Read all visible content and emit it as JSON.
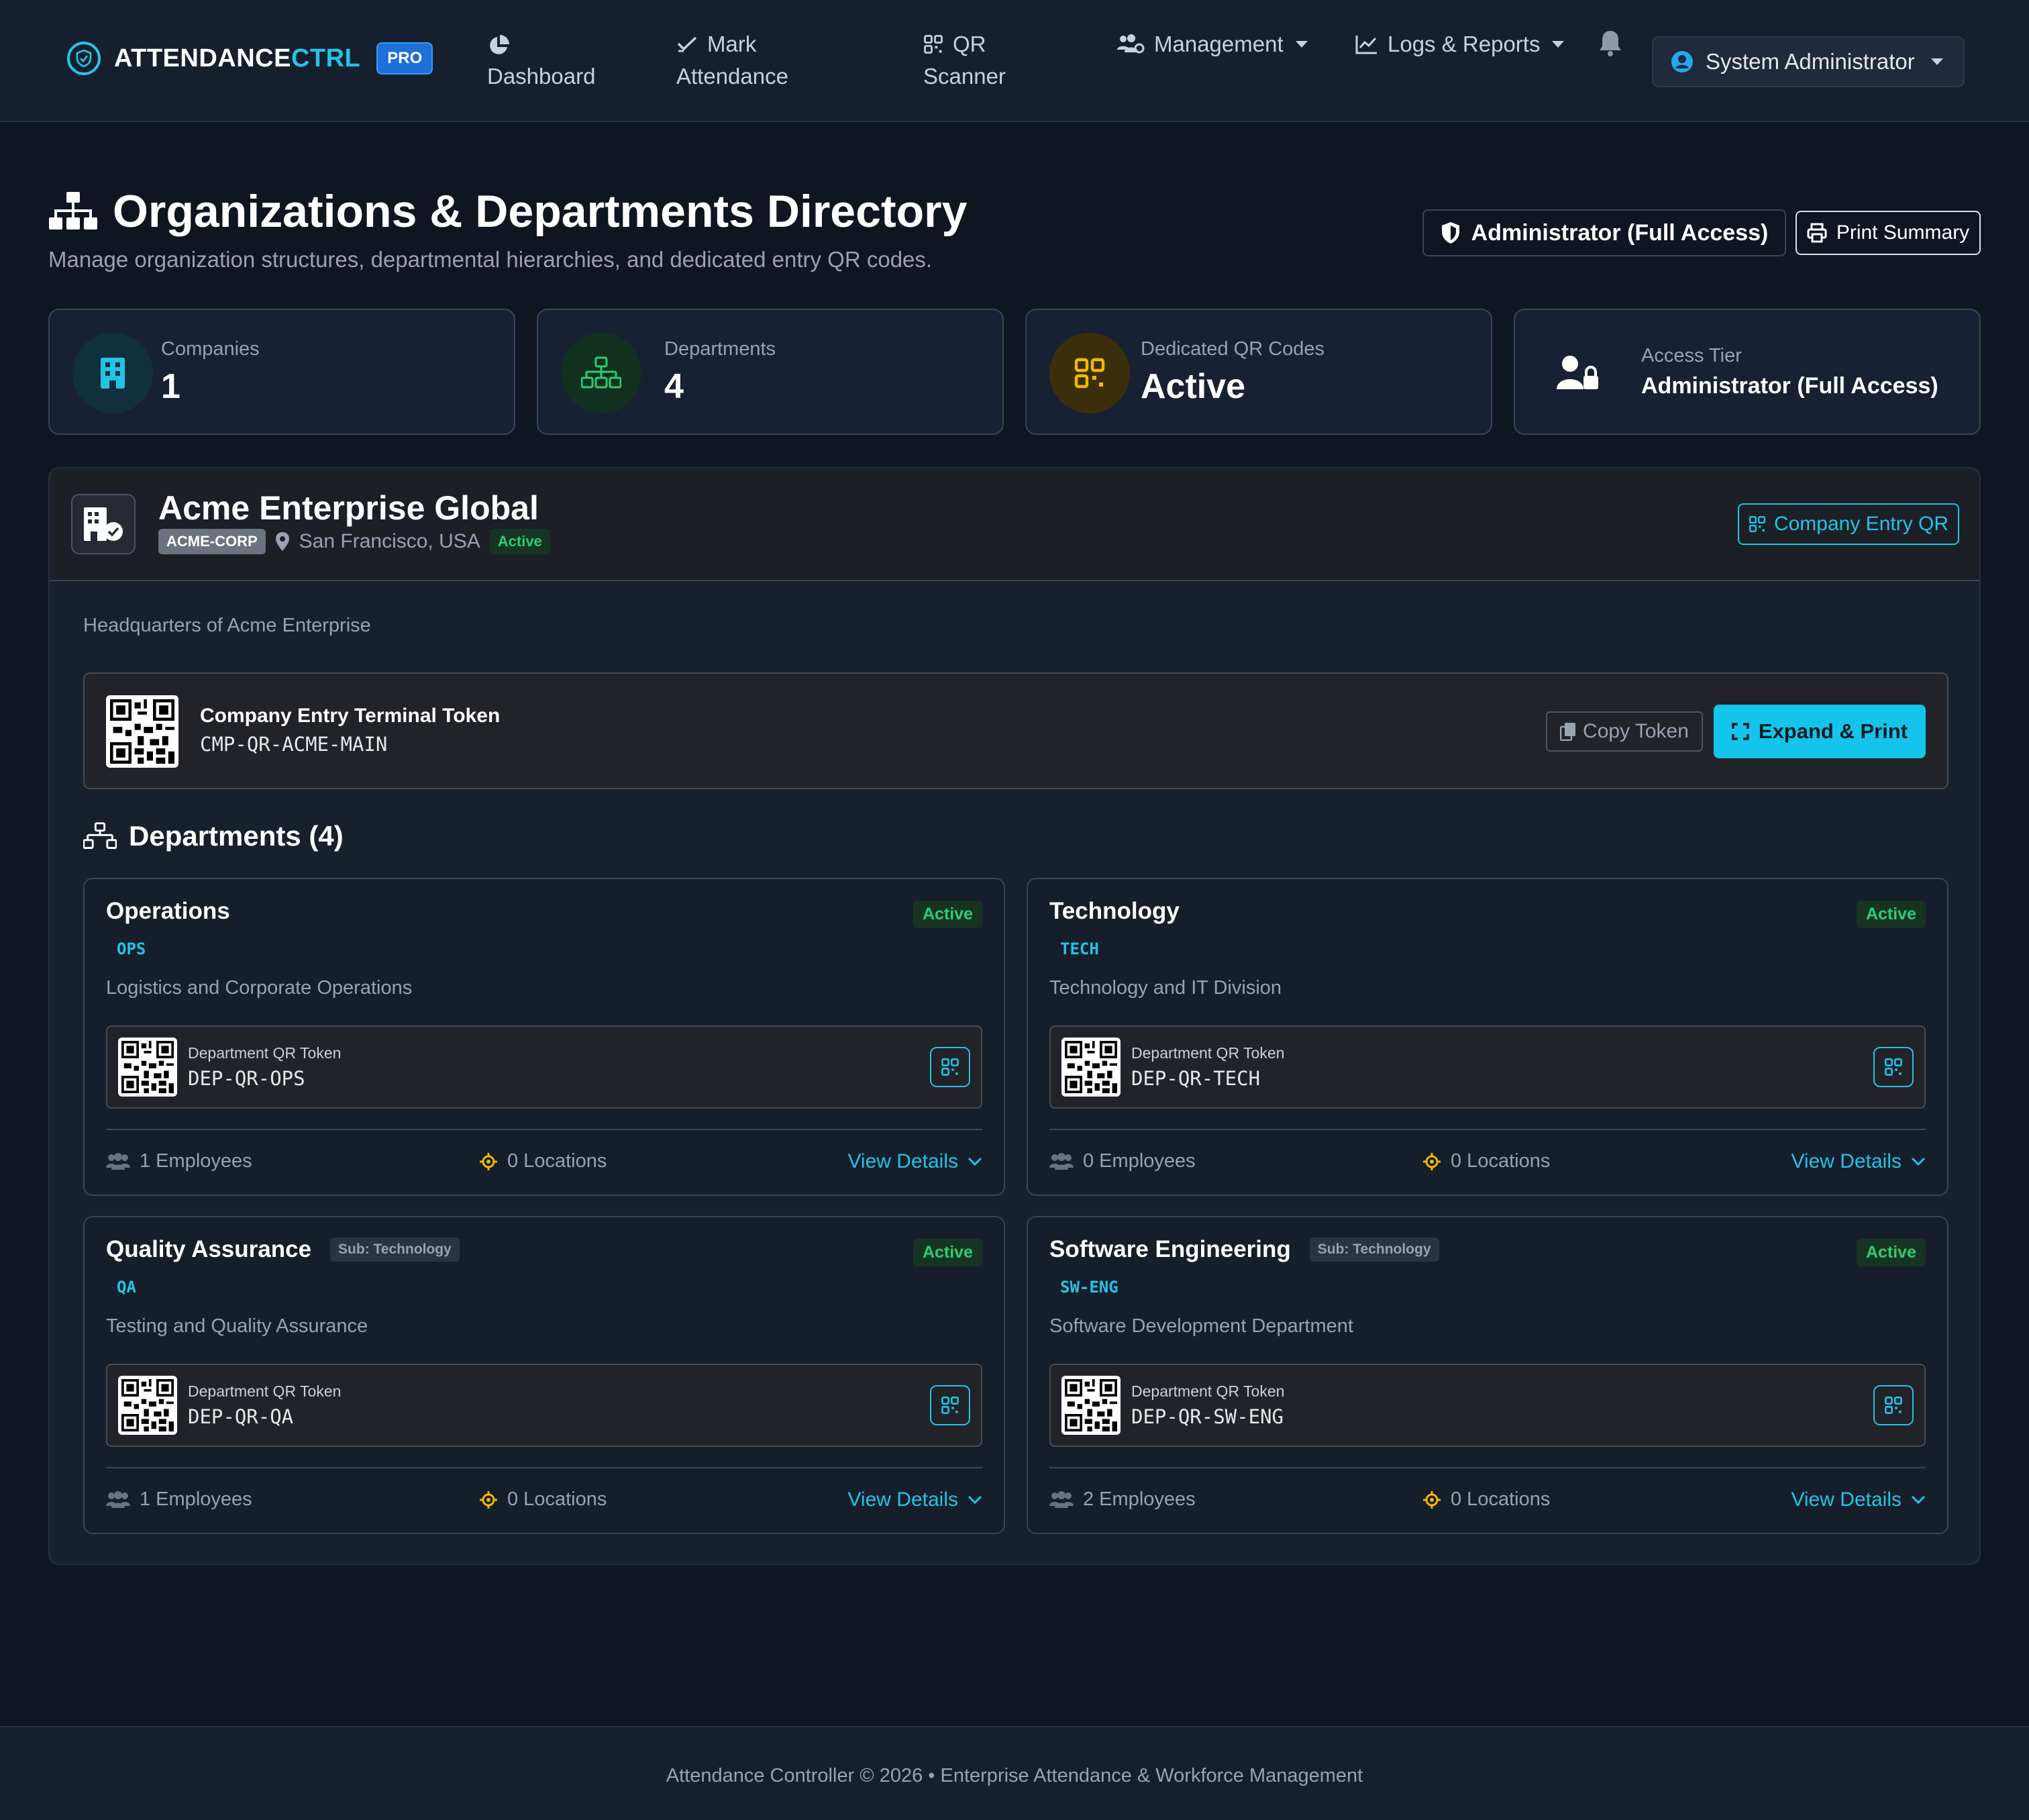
{
  "navbar": {
    "brand_main": "ATTENDANCE",
    "brand_accent": "CTRL",
    "brand_badge": "PRO",
    "items": [
      {
        "icon": "pie-chart-icon",
        "label": "Dashboard"
      },
      {
        "icon": "check-icon",
        "label_1": "Mark",
        "label_2": "Attendance"
      },
      {
        "icon": "qr-icon",
        "label_1": "QR",
        "label_2": "Scanner"
      },
      {
        "icon": "users-gear-icon",
        "label": "Management"
      },
      {
        "icon": "line-chart-icon",
        "label": "Logs & Reports"
      }
    ],
    "user_label": "System Administrator"
  },
  "header": {
    "title": "Organizations & Departments Directory",
    "subtitle": "Manage organization structures, departmental hierarchies, and dedicated entry QR codes.",
    "access_label": "Administrator (Full Access)",
    "print_label": "Print Summary"
  },
  "stats": [
    {
      "label": "Companies",
      "value": "1",
      "icon": "building-icon",
      "color": "#22c4e6"
    },
    {
      "label": "Departments",
      "value": "4",
      "icon": "sitemap-icon",
      "color": "#2ecc71"
    },
    {
      "label": "Dedicated QR Codes",
      "value": "Active",
      "icon": "qr-icon",
      "color": "#f5b800"
    },
    {
      "label": "Access Tier",
      "value": "Administrator (Full Access)",
      "icon": "user-lock-icon",
      "color": "#ffffff"
    }
  ],
  "company": {
    "name": "Acme Enterprise Global",
    "code": "ACME-CORP",
    "location": "San Francisco, USA",
    "status": "Active",
    "entry_qr_label": "Company Entry QR",
    "description": "Headquarters of Acme Enterprise",
    "token_title": "Company Entry Terminal Token",
    "token_value": "CMP-QR-ACME-MAIN",
    "copy_label": "Copy Token",
    "expand_label": "Expand & Print"
  },
  "departments_heading": "Departments (4)",
  "departments": [
    {
      "name": "Operations",
      "sub": "",
      "code": "OPS",
      "status": "Active",
      "description": "Logistics and Corporate Operations",
      "token_label": "Department QR Token",
      "token": "DEP-QR-OPS",
      "employees": "1 Employees",
      "locations": "0 Locations",
      "view_label": "View Details"
    },
    {
      "name": "Technology",
      "sub": "",
      "code": "TECH",
      "status": "Active",
      "description": "Technology and IT Division",
      "token_label": "Department QR Token",
      "token": "DEP-QR-TECH",
      "employees": "0 Employees",
      "locations": "0 Locations",
      "view_label": "View Details"
    },
    {
      "name": "Quality Assurance",
      "sub": "Sub: Technology",
      "code": "QA",
      "status": "Active",
      "description": "Testing and Quality Assurance",
      "token_label": "Department QR Token",
      "token": "DEP-QR-QA",
      "employees": "1 Employees",
      "locations": "0 Locations",
      "view_label": "View Details"
    },
    {
      "name": "Software Engineering",
      "sub": "Sub: Technology",
      "code": "SW-ENG",
      "status": "Active",
      "description": "Software Development Department",
      "token_label": "Department QR Token",
      "token": "DEP-QR-SW-ENG",
      "employees": "2 Employees",
      "locations": "0 Locations",
      "view_label": "View Details"
    }
  ],
  "footer": {
    "text": "Attendance Controller © 2026 • Enterprise Attendance & Workforce Management"
  }
}
